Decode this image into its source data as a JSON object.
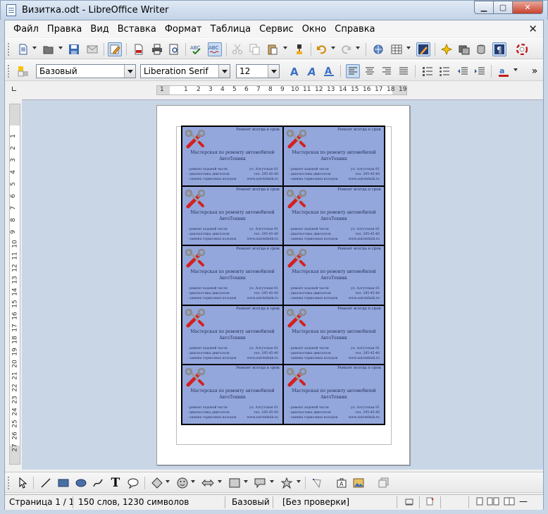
{
  "window": {
    "title": "Визитка.odt - LibreOffice Writer",
    "min_label": "▭",
    "max_label": "□",
    "close_label": "✕"
  },
  "menubar": {
    "items": [
      {
        "label": "Файл"
      },
      {
        "label": "Правка"
      },
      {
        "label": "Вид"
      },
      {
        "label": "Вставка"
      },
      {
        "label": "Формат"
      },
      {
        "label": "Таблица"
      },
      {
        "label": "Сервис"
      },
      {
        "label": "Окно"
      },
      {
        "label": "Справка"
      }
    ],
    "close_doc": "✕"
  },
  "toolbar_format": {
    "paragraph_style": "Базовый",
    "font_name": "Liberation Serif",
    "font_size": "12"
  },
  "ruler": {
    "h_numbers": [
      "1",
      "1",
      "2",
      "3",
      "4",
      "5",
      "6",
      "7",
      "8",
      "9",
      "10",
      "11",
      "12",
      "13",
      "14",
      "15",
      "16",
      "17",
      "18",
      "19"
    ],
    "v_numbers": [
      "1",
      "2",
      "3",
      "4",
      "5",
      "6",
      "7",
      "8",
      "9",
      "10",
      "11",
      "12",
      "13",
      "14",
      "15",
      "16",
      "17",
      "18",
      "19",
      "20",
      "21",
      "22",
      "23",
      "24",
      "25",
      "26",
      "27"
    ]
  },
  "card": {
    "slogan": "Ремонт всегда в срок",
    "name_line1": "Мастерская по ремонту автомобилей",
    "name_line2": "АвтоТехник",
    "services": [
      "- ремонт ходовой части",
      "- диагностика двигателя",
      "- замена тормозных колодок"
    ],
    "contacts": [
      "ул. Алгутская 81",
      "тел. 295-45-40",
      "www.autotehnik.ru"
    ]
  },
  "card_count": 10,
  "statusbar": {
    "page": "Страница 1 / 1",
    "words": "150 слов, 1230 символов",
    "style": "Базовый",
    "language": "[Без проверки]"
  },
  "colors": {
    "card_fill": "#94a7dc",
    "accent": "#6f93c3"
  }
}
